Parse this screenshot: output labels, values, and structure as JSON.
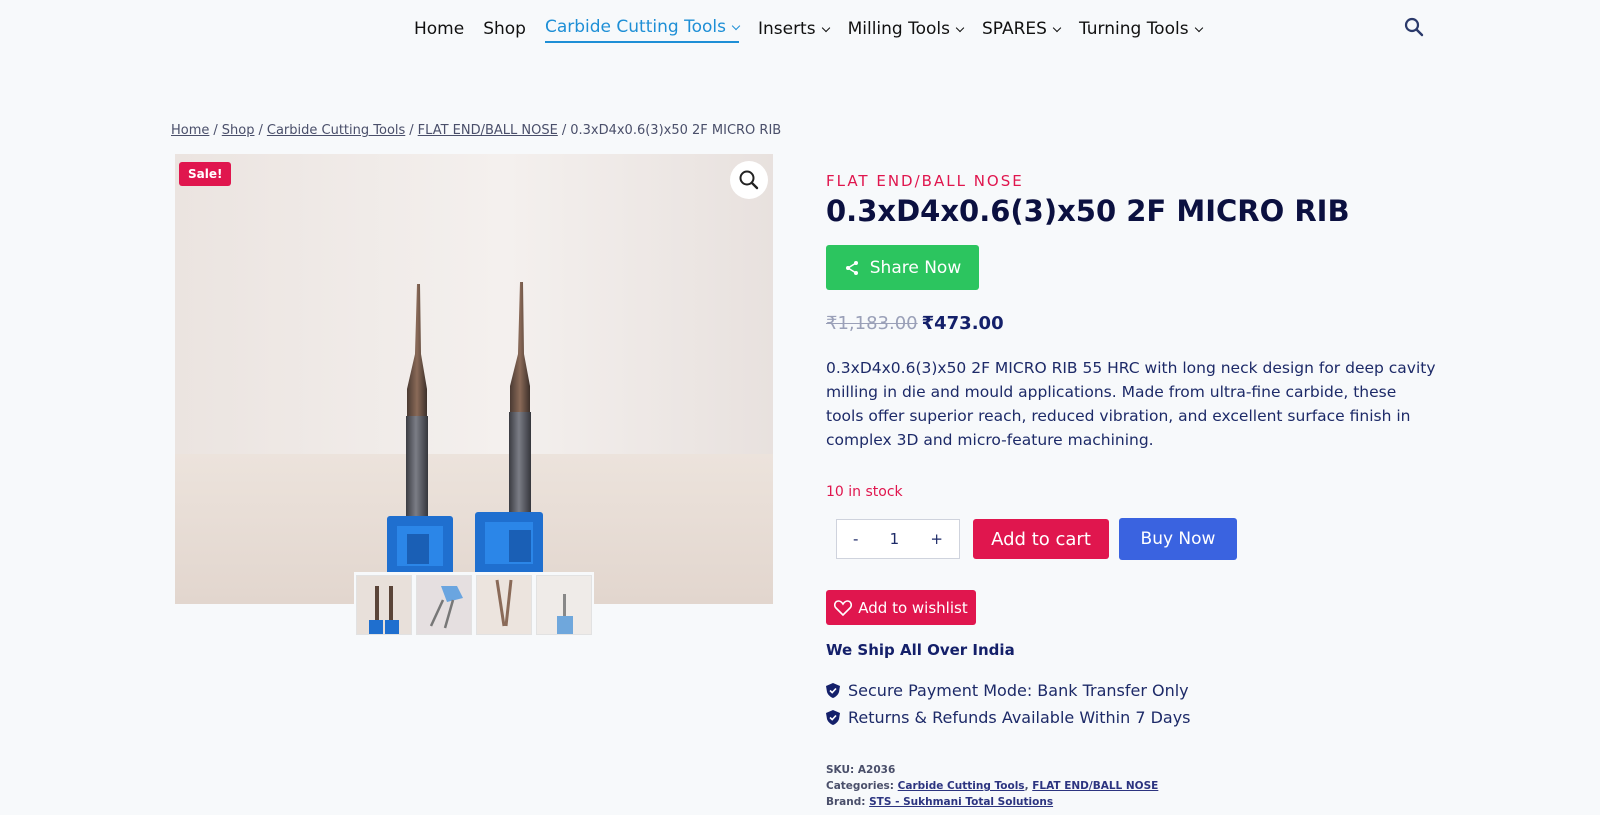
{
  "nav": {
    "items": [
      {
        "label": "Home",
        "dropdown": false,
        "active": false
      },
      {
        "label": "Shop",
        "dropdown": false,
        "active": false
      },
      {
        "label": "Carbide Cutting Tools",
        "dropdown": true,
        "active": true
      },
      {
        "label": "Inserts",
        "dropdown": true,
        "active": false
      },
      {
        "label": "Milling Tools",
        "dropdown": true,
        "active": false
      },
      {
        "label": "SPARES",
        "dropdown": true,
        "active": false
      },
      {
        "label": "Turning Tools",
        "dropdown": true,
        "active": false
      }
    ],
    "search_icon": "search-icon"
  },
  "breadcrumb": {
    "home": "Home",
    "shop": "Shop",
    "category": "Carbide Cutting Tools",
    "subcategory": "FLAT END/BALL NOSE",
    "current": "0.3xD4x0.6(3)x50 2F MICRO RIB",
    "separator": "/"
  },
  "gallery": {
    "sale_badge": "Sale!",
    "zoom_icon": "magnifier-icon",
    "thumbnail_count": 4
  },
  "product": {
    "category_label": "FLAT END/BALL NOSE",
    "title": "0.3xD4x0.6(3)x50 2F MICRO RIB",
    "share_label": "Share Now",
    "old_price": "₹1,183.00",
    "new_price": "₹473.00",
    "description": "0.3xD4x0.6(3)x50 2F MICRO RIB 55 HRC with long neck design for deep cavity milling in die and mould applications. Made from ultra-fine carbide, these tools offer superior reach, reduced vibration, and excellent surface finish in complex 3D and micro-feature machining.",
    "stock": "10 in stock",
    "qty_minus": "-",
    "qty_value": "1",
    "qty_plus": "+",
    "add_to_cart": "Add to cart",
    "buy_now": "Buy Now",
    "wishlist": "Add to wishlist",
    "shipping": "We Ship All Over India",
    "features": [
      "Secure Payment Mode: Bank Transfer Only",
      "Returns & Refunds Available Within 7 Days"
    ],
    "meta": {
      "sku_label": "SKU:",
      "sku": "A2036",
      "categories_label": "Categories:",
      "category_1": "Carbide Cutting Tools",
      "category_2": "FLAT END/BALL NOSE",
      "brand_label": "Brand:",
      "brand": "STS - Sukhmani Total Solutions"
    }
  },
  "colors": {
    "accent_red": "#e0164e",
    "share_green": "#2cc55f",
    "buy_blue": "#3a63e0",
    "nav_active": "#1e8fd6",
    "text_navy": "#14206a"
  }
}
